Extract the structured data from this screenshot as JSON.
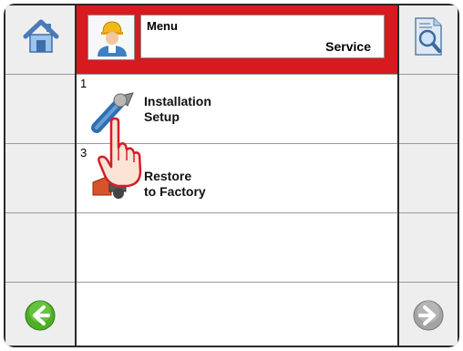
{
  "header": {
    "menu_label": "Menu",
    "menu_title": "Service",
    "avatar_icon": "service-technician-icon",
    "home_icon": "home-icon",
    "search_icon": "search-document-icon"
  },
  "menu_items": [
    {
      "number": "1",
      "line1": "Installation",
      "line2": "Setup",
      "icon": "wrench-icon"
    },
    {
      "number": "3",
      "line1": "Restore",
      "line2": "to Factory",
      "icon": "factory-reset-icon"
    }
  ],
  "footer": {
    "back_icon": "back-arrow-icon",
    "forward_icon": "forward-arrow-icon"
  },
  "colors": {
    "header_red": "#d71920",
    "back_green": "#4caf25",
    "forward_gray": "#9a9a9a",
    "frame": "#2a2a2a"
  },
  "cursor_icon": "pointing-hand-cursor-icon"
}
